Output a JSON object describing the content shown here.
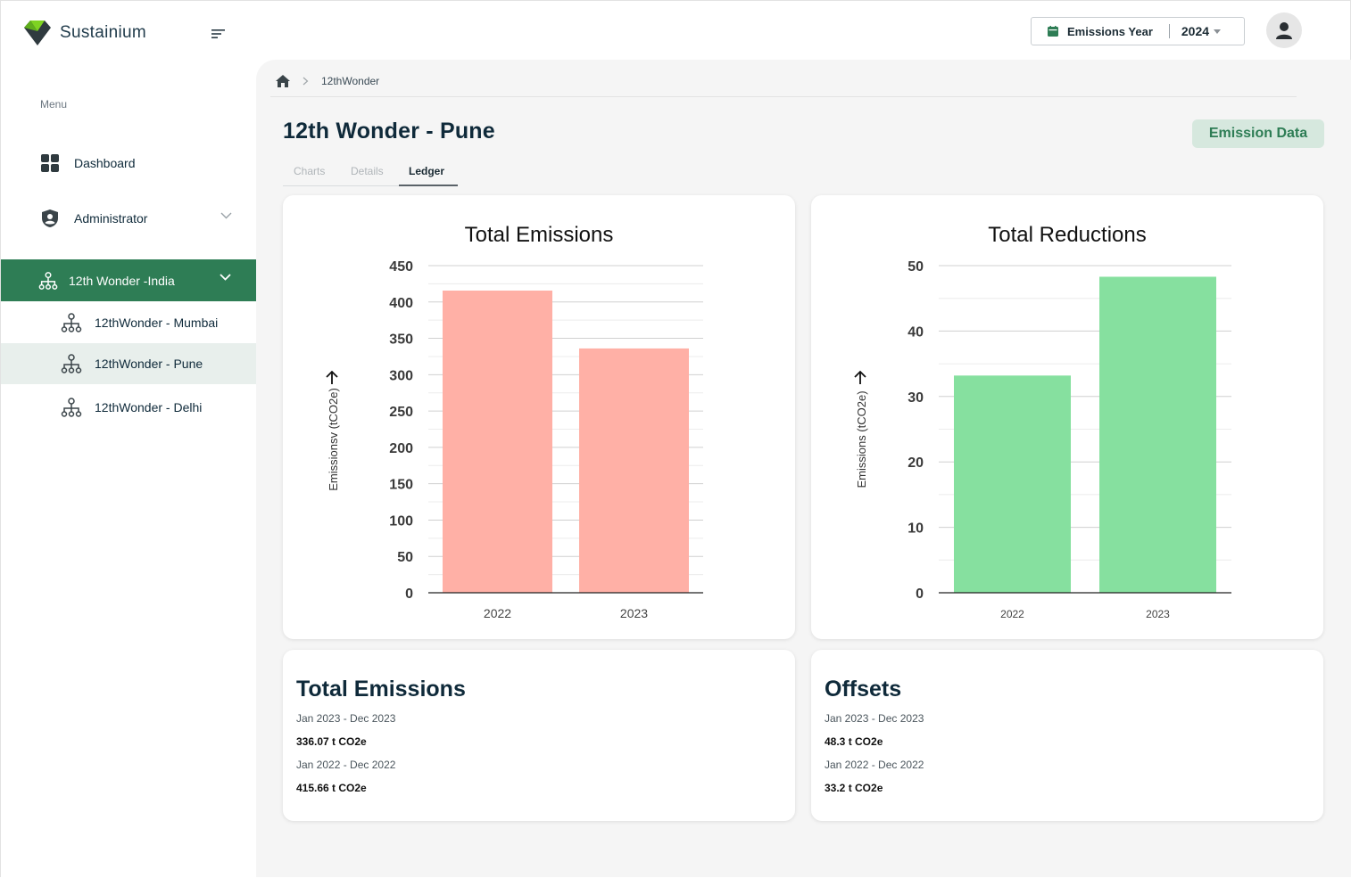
{
  "app": {
    "name": "Sustainium"
  },
  "sidebar": {
    "menu_label": "Menu",
    "items": [
      {
        "label": "Dashboard",
        "icon": "grid-icon"
      },
      {
        "label": "Administrator",
        "icon": "shield-user-icon"
      },
      {
        "label": "12th Wonder -India",
        "icon": "hierarchy-icon",
        "active": true
      }
    ],
    "sub_items": [
      {
        "label": "12thWonder - Mumbai"
      },
      {
        "label": "12thWonder - Pune",
        "selected": true
      },
      {
        "label": "12thWonder - Delhi"
      }
    ]
  },
  "topbar": {
    "year_label": "Emissions Year",
    "year_value": "2024"
  },
  "breadcrumb": {
    "current": "12thWonder"
  },
  "page": {
    "title": "12th Wonder - Pune",
    "action_button": "Emission Data",
    "tabs": [
      "Charts",
      "Details",
      "Ledger"
    ],
    "active_tab": "Ledger"
  },
  "chart_data": [
    {
      "type": "bar",
      "title": "Total Emissions",
      "ylabel": "Emissionsv (tCO2e)",
      "xlabel": "",
      "categories": [
        "2022",
        "2023"
      ],
      "values": [
        415.66,
        336.07
      ],
      "ylim": [
        0,
        450
      ],
      "yticks": [
        0,
        50,
        100,
        150,
        200,
        250,
        300,
        350,
        400,
        450
      ],
      "color": "#ffb0a6",
      "grid": true
    },
    {
      "type": "bar",
      "title": "Total Reductions",
      "ylabel": "Emissions (tCO2e)",
      "xlabel": "",
      "categories": [
        "2022",
        "2023"
      ],
      "values": [
        33.2,
        48.3
      ],
      "ylim": [
        0,
        50
      ],
      "yticks": [
        0,
        10,
        20,
        30,
        40,
        50
      ],
      "color": "#86e09f",
      "grid": true
    }
  ],
  "stats": [
    {
      "title": "Total Emissions",
      "rows": [
        {
          "period": "Jan 2023 - Dec 2023",
          "value": "336.07 t CO2e"
        },
        {
          "period": "Jan 2022 - Dec 2022",
          "value": "415.66 t CO2e"
        }
      ]
    },
    {
      "title": "Offsets",
      "rows": [
        {
          "period": "Jan 2023 - Dec 2023",
          "value": "48.3 t CO2e"
        },
        {
          "period": "Jan 2022 - Dec 2022",
          "value": "33.2 t CO2e"
        }
      ]
    }
  ],
  "colors": {
    "brand_green": "#2e7d55",
    "selected_bg": "#e8efec",
    "emissions_bar": "#ffb0a6",
    "reductions_bar": "#86e09f"
  }
}
